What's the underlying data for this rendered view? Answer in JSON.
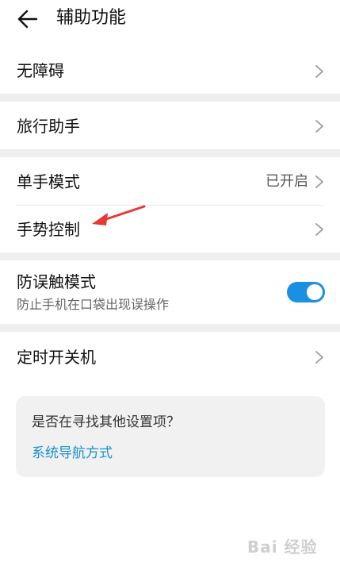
{
  "header": {
    "title": "辅助功能",
    "back_icon": "arrow-left-icon"
  },
  "rows": {
    "accessibility": {
      "label": "无障碍"
    },
    "travel_assistant": {
      "label": "旅行助手"
    },
    "one_handed_mode": {
      "label": "单手模式",
      "value": "已开启"
    },
    "gesture_control": {
      "label": "手势控制"
    },
    "accidental_touch": {
      "label": "防误触模式",
      "sub": "防止手机在口袋出现误操作",
      "toggle_on": true
    },
    "scheduled_power": {
      "label": "定时开关机"
    }
  },
  "card": {
    "question": "是否在寻找其他设置项？",
    "link": "系统导航方式"
  },
  "watermark": {
    "text": "Bai 经验"
  },
  "colors": {
    "accent": "#1a90e0",
    "link": "#1a8fcc",
    "annotation_arrow": "#e53935"
  }
}
